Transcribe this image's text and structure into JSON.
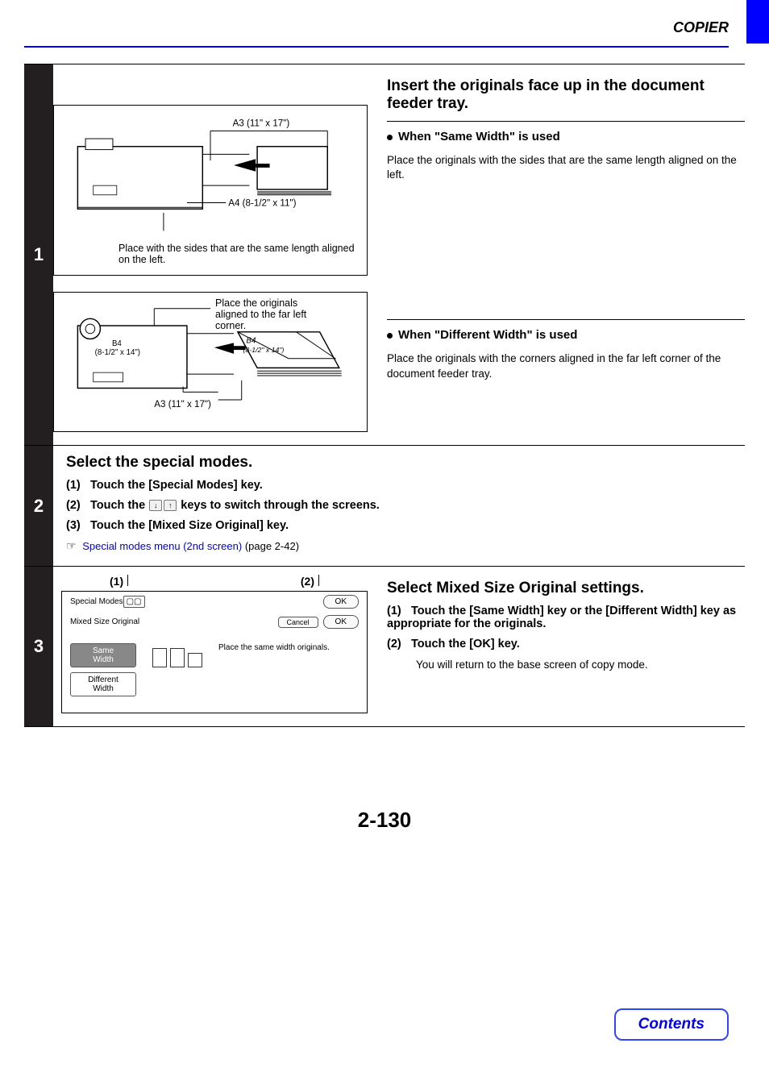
{
  "header": {
    "title": "COPIER"
  },
  "steps": {
    "one": {
      "number": "1",
      "title": "Insert the originals face up in the document feeder tray.",
      "sameWidth": {
        "label": "When \"Same Width\" is used",
        "desc": "Place the originals with the sides that are the same length aligned on the left.",
        "diag": {
          "a3": "A3 (11\" x 17\")",
          "a4": "A4 (8-1/2\" x 11\")",
          "caption": "Place with the sides that are the same length aligned on the left."
        }
      },
      "diffWidth": {
        "label": "When \"Different Width\" is used",
        "desc": "Place the originals with the corners aligned in the far left corner of the document feeder tray.",
        "diag": {
          "b4": "B4",
          "b4size": "(8-1/2\" x 14\")",
          "b4paper": "B4",
          "b4papersize": "(8-1/2\" x 14\")",
          "a3": "A3 (11\" x 17\")",
          "caption": "Place the originals aligned to the far left corner."
        }
      }
    },
    "two": {
      "number": "2",
      "title": "Select the special modes.",
      "items": {
        "i1": {
          "num": "(1)",
          "text": "Touch the [Special Modes] key."
        },
        "i2": {
          "before": "Touch the",
          "after": "keys to switch through the screens.",
          "num": "(2)"
        },
        "i3": {
          "num": "(3)",
          "text": "Touch the [Mixed Size Original] key."
        }
      },
      "link": {
        "text": "Special modes menu (2nd screen)",
        "page": "(page 2-42)"
      }
    },
    "three": {
      "number": "3",
      "title": "Select Mixed Size Original settings.",
      "callouts": {
        "c1": "(1)",
        "c2": "(2)"
      },
      "mock": {
        "specialModes": "Special Modes",
        "ok1": "OK",
        "mixedSize": "Mixed Size Original",
        "cancel": "Cancel",
        "ok2": "OK",
        "sameWidth": "Same Width",
        "diffWidth": "Different\nWidth",
        "note": "Place the same width originals."
      },
      "items": {
        "i1": {
          "num": "(1)",
          "text": "Touch the [Same Width] key or the [Different Width] key as appropriate for the originals."
        },
        "i2": {
          "num": "(2)",
          "text": "Touch the [OK] key.",
          "sub": "You will return to the base screen of copy mode."
        }
      }
    }
  },
  "icons": {
    "down": "↓",
    "up": "↑",
    "pointer": "☞"
  },
  "pageNumber": "2-130",
  "contentsLabel": "Contents"
}
